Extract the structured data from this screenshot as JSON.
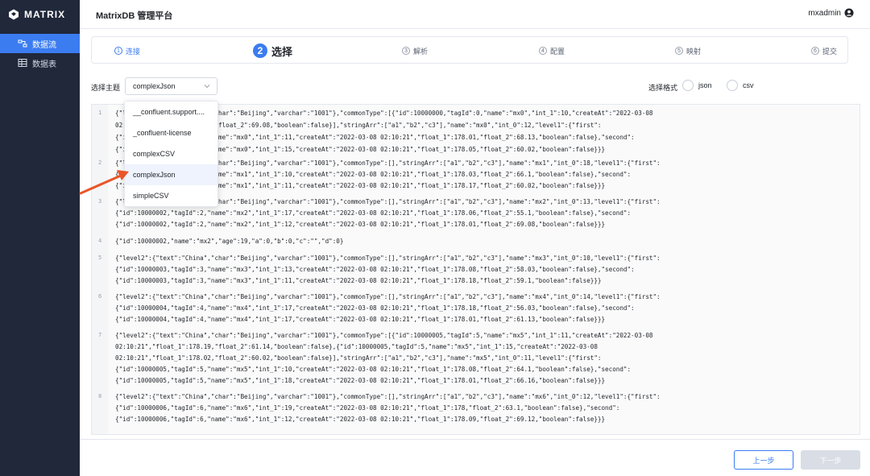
{
  "app": {
    "logo_text": "MATRIX",
    "title": "MatrixDB 管理平台",
    "user": "mxadmin"
  },
  "sidebar": {
    "items": [
      {
        "label": "数据流",
        "icon": "dataflow-icon",
        "active": true
      },
      {
        "label": "数据表",
        "icon": "table-icon",
        "active": false
      }
    ]
  },
  "steps": [
    {
      "num": "1",
      "label": "连接",
      "state": "done"
    },
    {
      "num": "2",
      "label": "选择",
      "state": "active"
    },
    {
      "num": "3",
      "label": "解析",
      "state": "pending"
    },
    {
      "num": "4",
      "label": "配置",
      "state": "pending"
    },
    {
      "num": "5",
      "label": "映射",
      "state": "pending"
    },
    {
      "num": "6",
      "label": "提交",
      "state": "pending"
    }
  ],
  "form": {
    "topic_label": "选择主题",
    "topic_value": "complexJson",
    "format_label": "选择格式",
    "format_options": [
      "json",
      "csv"
    ]
  },
  "dropdown": {
    "options": [
      "__confluent.support....",
      "_confluent-license",
      "complexCSV",
      "complexJson",
      "simpleCSV"
    ],
    "selected": "complexJson"
  },
  "code": {
    "lines": [
      {
        "n": "1",
        "segs": [
          "{\"level2\":{\"text\":\"China\",\"char\":\"Beijing\",\"varchar\":\"1001\"},\"commonType\":[{\"id\":10000000,\"tagId\":0,\"name\":\"mx0\",\"int_1\":10,\"createAt\":\"2022-03-08",
          "02:10:21\",\"float_1\":178.05,\"float_2\":69.08,\"boolean\":false}],\"stringArr\":[\"a1\",\"b2\",\"c3\"],\"name\":\"mx0\",\"int_0\":12,\"level1\":{\"first\":",
          "{\"id\":10000000,\"tagId\":0,\"name\":\"mx0\",\"int_1\":11,\"createAt\":\"2022-03-08 02:10:21\",\"float_1\":178.01,\"float_2\":68.13,\"boolean\":false},\"second\":",
          "{\"id\":10000000,\"tagId\":0,\"name\":\"mx0\",\"int_1\":15,\"createAt\":\"2022-03-08 02:10:21\",\"float_1\":178.05,\"float_2\":60.02,\"boolean\":false}}}"
        ]
      },
      {
        "n": "2",
        "segs": [
          "{\"level2\":{\"text\":\"China\",\"char\":\"Beijing\",\"varchar\":\"1001\"},\"commonType\":[],\"stringArr\":[\"a1\",\"b2\",\"c3\"],\"name\":\"mx1\",\"int_0\":18,\"level1\":{\"first\":",
          "{\"id\":10000001,\"tagId\":1,\"name\":\"mx1\",\"int_1\":10,\"createAt\":\"2022-03-08 02:10:21\",\"float_1\":178.03,\"float_2\":66.1,\"boolean\":false},\"second\":",
          "{\"id\":10000001,\"tagId\":1,\"name\":\"mx1\",\"int_1\":11,\"createAt\":\"2022-03-08 02:10:21\",\"float_1\":178.17,\"float_2\":60.02,\"boolean\":false}}}"
        ]
      },
      {
        "n": "3",
        "segs": [
          "{\"level2\":{\"text\":\"China\",\"char\":\"Beijing\",\"varchar\":\"1001\"},\"commonType\":[],\"stringArr\":[\"a1\",\"b2\",\"c3\"],\"name\":\"mx2\",\"int_0\":13,\"level1\":{\"first\":",
          "{\"id\":10000002,\"tagId\":2,\"name\":\"mx2\",\"int_1\":17,\"createAt\":\"2022-03-08 02:10:21\",\"float_1\":178.06,\"float_2\":55.1,\"boolean\":false},\"second\":",
          "{\"id\":10000002,\"tagId\":2,\"name\":\"mx2\",\"int_1\":12,\"createAt\":\"2022-03-08 02:10:21\",\"float_1\":178.01,\"float_2\":69.08,\"boolean\":false}}}"
        ]
      },
      {
        "n": "4",
        "segs": [
          "{\"id\":10000002,\"name\":\"mx2\",\"age\":19,\"a\":0,\"b\":0,\"c\":\"\",\"d\":0}"
        ]
      },
      {
        "n": "5",
        "segs": [
          "{\"level2\":{\"text\":\"China\",\"char\":\"Beijing\",\"varchar\":\"1001\"},\"commonType\":[],\"stringArr\":[\"a1\",\"b2\",\"c3\"],\"name\":\"mx3\",\"int_0\":10,\"level1\":{\"first\":",
          "{\"id\":10000003,\"tagId\":3,\"name\":\"mx3\",\"int_1\":13,\"createAt\":\"2022-03-08 02:10:21\",\"float_1\":178.08,\"float_2\":58.03,\"boolean\":false},\"second\":",
          "{\"id\":10000003,\"tagId\":3,\"name\":\"mx3\",\"int_1\":11,\"createAt\":\"2022-03-08 02:10:21\",\"float_1\":178.18,\"float_2\":59.1,\"boolean\":false}}}"
        ]
      },
      {
        "n": "6",
        "segs": [
          "{\"level2\":{\"text\":\"China\",\"char\":\"Beijing\",\"varchar\":\"1001\"},\"commonType\":[],\"stringArr\":[\"a1\",\"b2\",\"c3\"],\"name\":\"mx4\",\"int_0\":14,\"level1\":{\"first\":",
          "{\"id\":10000004,\"tagId\":4,\"name\":\"mx4\",\"int_1\":17,\"createAt\":\"2022-03-08 02:10:21\",\"float_1\":178.18,\"float_2\":56.03,\"boolean\":false},\"second\":",
          "{\"id\":10000004,\"tagId\":4,\"name\":\"mx4\",\"int_1\":17,\"createAt\":\"2022-03-08 02:10:21\",\"float_1\":178.01,\"float_2\":61.13,\"boolean\":false}}}"
        ]
      },
      {
        "n": "7",
        "segs": [
          "{\"level2\":{\"text\":\"China\",\"char\":\"Beijing\",\"varchar\":\"1001\"},\"commonType\":[{\"id\":10000005,\"tagId\":5,\"name\":\"mx5\",\"int_1\":11,\"createAt\":\"2022-03-08",
          "02:10:21\",\"float_1\":178.19,\"float_2\":61.14,\"boolean\":false},{\"id\":10000005,\"tagId\":5,\"name\":\"mx5\",\"int_1\":15,\"createAt\":\"2022-03-08",
          "02:10:21\",\"float_1\":178.02,\"float_2\":60.02,\"boolean\":false}],\"stringArr\":[\"a1\",\"b2\",\"c3\"],\"name\":\"mx5\",\"int_0\":11,\"level1\":{\"first\":",
          "{\"id\":10000005,\"tagId\":5,\"name\":\"mx5\",\"int_1\":10,\"createAt\":\"2022-03-08 02:10:21\",\"float_1\":178.08,\"float_2\":64.1,\"boolean\":false},\"second\":",
          "{\"id\":10000005,\"tagId\":5,\"name\":\"mx5\",\"int_1\":18,\"createAt\":\"2022-03-08 02:10:21\",\"float_1\":178.01,\"float_2\":66.16,\"boolean\":false}}}"
        ]
      },
      {
        "n": "8",
        "segs": [
          "{\"level2\":{\"text\":\"China\",\"char\":\"Beijing\",\"varchar\":\"1001\"},\"commonType\":[],\"stringArr\":[\"a1\",\"b2\",\"c3\"],\"name\":\"mx6\",\"int_0\":12,\"level1\":{\"first\":",
          "{\"id\":10000006,\"tagId\":6,\"name\":\"mx6\",\"int_1\":19,\"createAt\":\"2022-03-08 02:10:21\",\"float_1\":178,\"float_2\":63.1,\"boolean\":false},\"second\":",
          "{\"id\":10000006,\"tagId\":6,\"name\":\"mx6\",\"int_1\":12,\"createAt\":\"2022-03-08 02:10:21\",\"float_1\":178.09,\"float_2\":69.12,\"boolean\":false}}}"
        ]
      }
    ]
  },
  "footer": {
    "prev_label": "上一步",
    "next_label": "下一步"
  },
  "colors": {
    "sidebar": "#20283a",
    "accent": "#3b7cf0",
    "annotation_arrow": "#e8562a"
  }
}
